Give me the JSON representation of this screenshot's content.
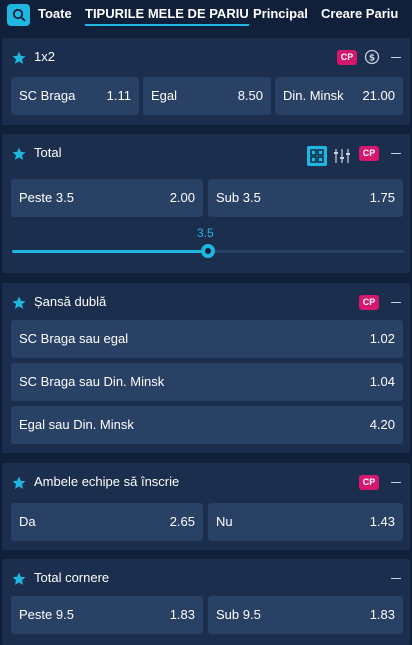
{
  "tabs": [
    {
      "label": "Toate"
    },
    {
      "label": "TIPURILE MELE DE PARIU"
    },
    {
      "label": "Principal"
    },
    {
      "label": "Creare Pariu"
    }
  ],
  "markets": {
    "m1x2": {
      "title": "1x2",
      "badge": "CP",
      "odds": [
        {
          "label": "SC Braga",
          "value": "1.11"
        },
        {
          "label": "Egal",
          "value": "8.50"
        },
        {
          "label": "Din. Minsk",
          "value": "21.00"
        }
      ]
    },
    "total": {
      "title": "Total",
      "badge": "CP",
      "odds": [
        {
          "label": "Peste 3.5",
          "value": "2.00"
        },
        {
          "label": "Sub 3.5",
          "value": "1.75"
        }
      ],
      "slider": {
        "value": "3.5",
        "fraction": 0.5
      }
    },
    "double_chance": {
      "title": "Șansă dublă",
      "badge": "CP",
      "odds": [
        {
          "label": "SC Braga sau egal",
          "value": "1.02"
        },
        {
          "label": "SC Braga sau Din. Minsk",
          "value": "1.04"
        },
        {
          "label": "Egal sau Din. Minsk",
          "value": "4.20"
        }
      ]
    },
    "btts": {
      "title": "Ambele echipe să înscrie",
      "badge": "CP",
      "odds": [
        {
          "label": "Da",
          "value": "2.65"
        },
        {
          "label": "Nu",
          "value": "1.43"
        }
      ]
    },
    "corners": {
      "title": "Total cornere",
      "odds": [
        {
          "label": "Peste 9.5",
          "value": "1.83"
        },
        {
          "label": "Sub 9.5",
          "value": "1.83"
        }
      ]
    }
  },
  "colors": {
    "accent": "#1fb6e0",
    "badge": "#d6176e",
    "card": "#1b2e4d",
    "odd_button": "#2a4166",
    "background": "#10203a"
  }
}
